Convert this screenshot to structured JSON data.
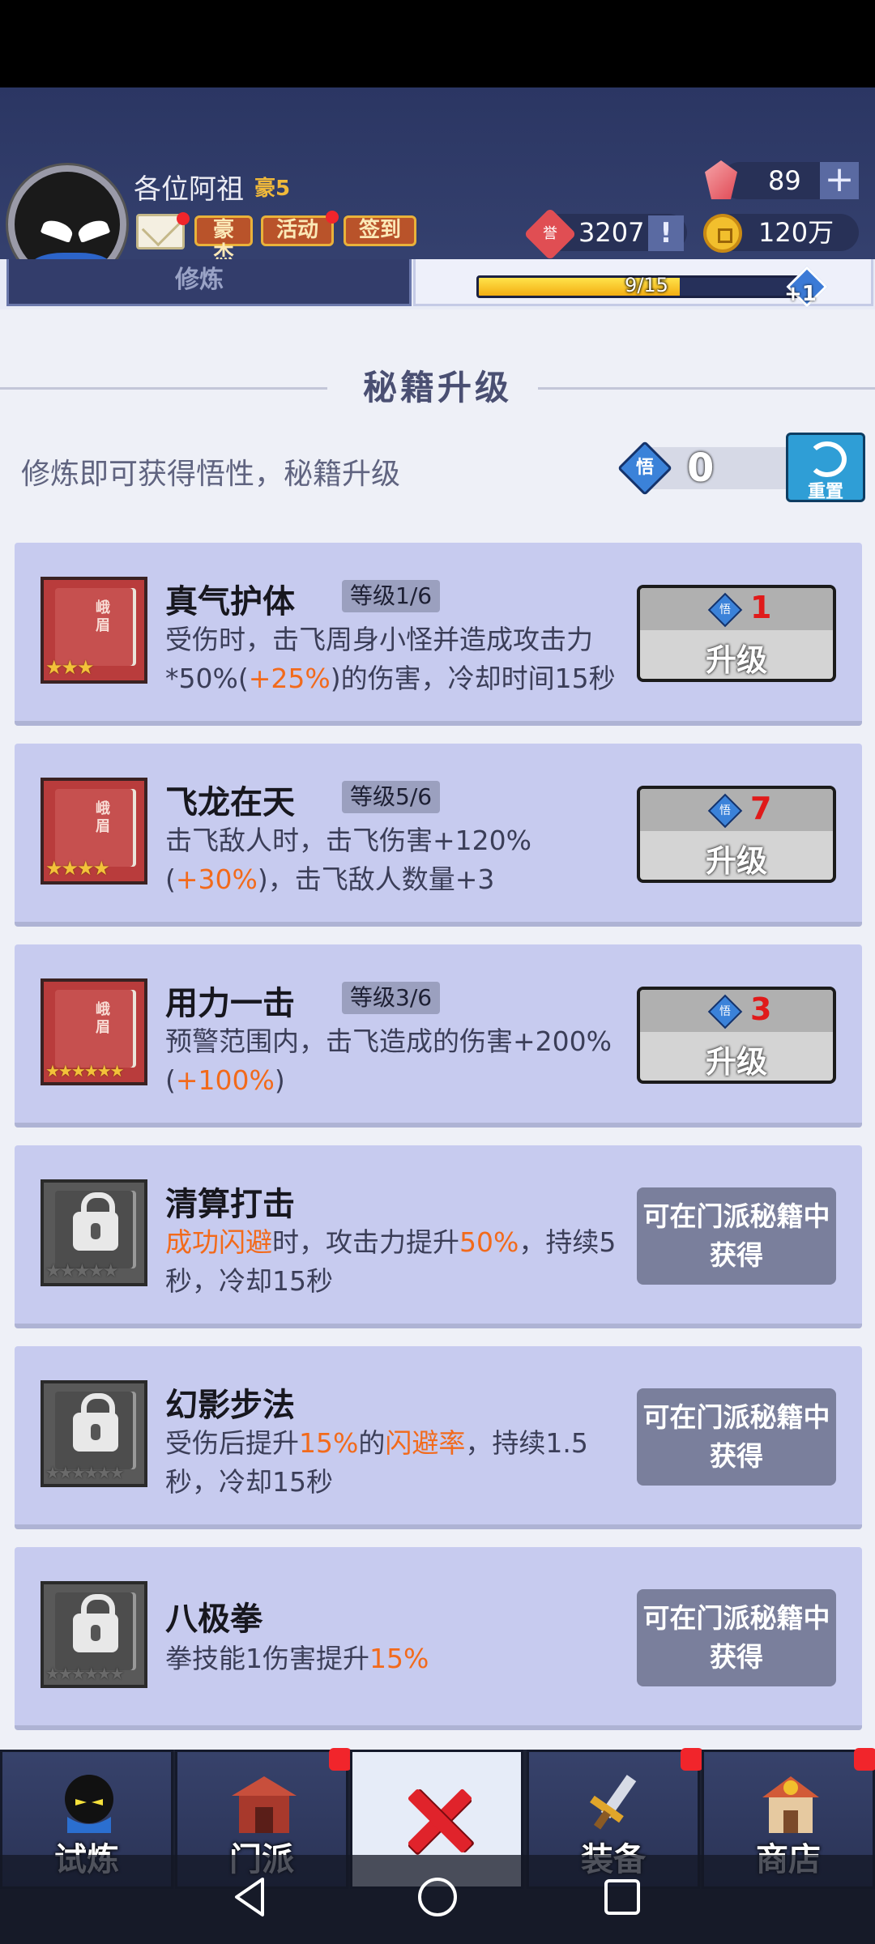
{
  "header": {
    "player_name": "各位阿祖",
    "vip": "豪5",
    "buttons": [
      "豪杰",
      "活动",
      "签到"
    ],
    "gems": "89",
    "honor": "3207",
    "gold": "120万",
    "plus": "+",
    "alert": "!"
  },
  "subnav": {
    "left_tab": "修炼",
    "exp_text": "9/15",
    "exp_progress": 0.6,
    "exp_badge": "+1"
  },
  "section": {
    "title": "秘籍升级",
    "hint": "修炼即可获得悟性，秘籍升级",
    "wu_symbol": "悟",
    "wu_count": "0",
    "reset_label": "重置"
  },
  "skills": [
    {
      "name": "真气护体",
      "level": "等级1/6",
      "book": "峨眉",
      "stars": "★★★",
      "desc_parts": [
        "受伤时，击飞周身小怪并造成攻击力*50%(",
        "+25%",
        ")的伤害，冷却时间15秒"
      ],
      "cost": "1",
      "button": "升级"
    },
    {
      "name": "飞龙在天",
      "level": "等级5/6",
      "book": "峨眉",
      "stars": "★★★★",
      "desc_parts": [
        "击飞敌人时，击飞伤害+120%(",
        "+30%",
        ")，击飞敌人数量+3"
      ],
      "cost": "7",
      "button": "升级"
    },
    {
      "name": "用力一击",
      "level": "等级3/6",
      "book": "峨眉",
      "stars": "★★★★★★",
      "desc_parts": [
        "预警范围内，击飞造成的伤害+200%(",
        "+100%",
        ")"
      ],
      "cost": "3",
      "button": "升级"
    },
    {
      "name": "清算打击",
      "stars": "★★★★★",
      "desc_parts": [
        "",
        "成功闪避",
        "时，攻击力提升",
        "50%",
        "，持续5秒，冷却15秒"
      ],
      "obtain": "可在门派秘籍中获得"
    },
    {
      "name": "幻影步法",
      "stars": "★★★★★★",
      "desc_parts": [
        "受伤后提升",
        "15%",
        "的",
        "闪避率",
        "，持续1.5秒，冷却15秒"
      ],
      "obtain": "可在门派秘籍中获得"
    },
    {
      "name": "八极拳",
      "stars": "★★★★★★",
      "desc_parts": [
        "拳技能1伤害提升",
        "15%"
      ],
      "obtain": "可在门派秘籍中获得"
    }
  ],
  "nav": {
    "tabs": [
      "试炼",
      "门派",
      "",
      "装备",
      "商店"
    ]
  },
  "colors": {
    "accent": "#f26a1b",
    "cost_red": "#e01a1a",
    "card_bg": "#c7cbef"
  }
}
